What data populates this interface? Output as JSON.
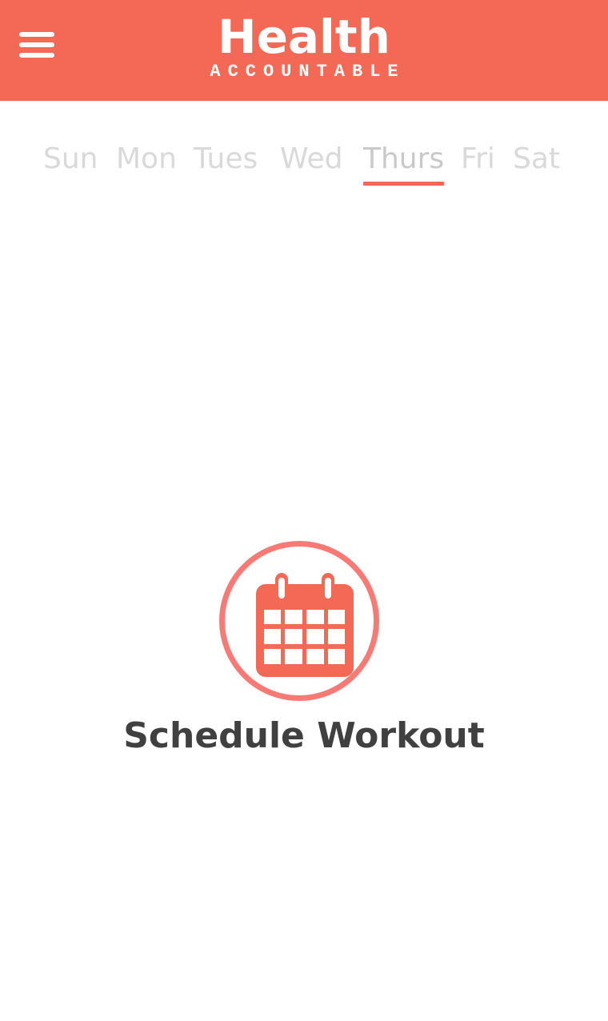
{
  "header": {
    "title": "Health",
    "subtitle": "ACCOUNTABLE",
    "menu_icon": "hamburger-menu-icon",
    "background_color": "#f46955"
  },
  "days": {
    "items": [
      "Sun",
      "Mon",
      "Tues",
      "Wed",
      "Thurs",
      "Fri",
      "Sat"
    ],
    "selected": "Thurs",
    "selected_underline_color": "#f46955"
  },
  "main": {
    "schedule_label": "Schedule Workout",
    "schedule_icon": "calendar-icon",
    "icon_color": "#f46955"
  }
}
